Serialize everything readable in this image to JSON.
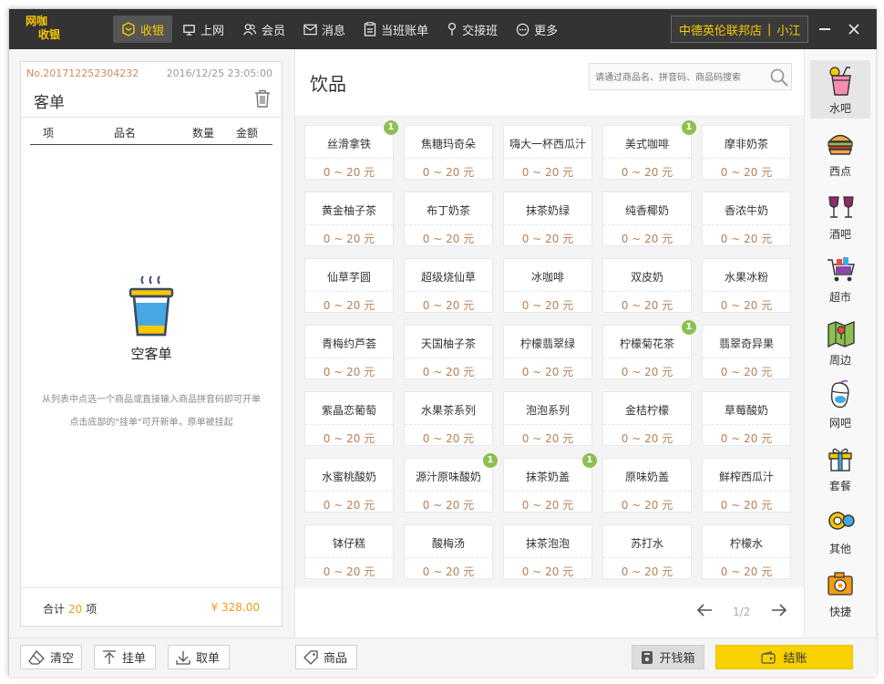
{
  "app": {
    "logo_line1": "网咖",
    "logo_line2": "收银"
  },
  "nav": [
    {
      "label": "收银",
      "icon": "cashier-icon",
      "active": true
    },
    {
      "label": "上网",
      "icon": "monitor-icon",
      "active": false
    },
    {
      "label": "会员",
      "icon": "members-icon",
      "active": false
    },
    {
      "label": "消息",
      "icon": "mail-icon",
      "active": false
    },
    {
      "label": "当班账单",
      "icon": "bill-icon",
      "active": false
    },
    {
      "label": "交接班",
      "icon": "pin-icon",
      "active": false
    },
    {
      "label": "更多",
      "icon": "more-icon",
      "active": false
    }
  ],
  "store": {
    "name": "中德英伦联邦店",
    "user": "小江"
  },
  "order": {
    "number": "No.201712252304232",
    "time": "2016/12/25 23:05:00",
    "title": "客单",
    "columns": [
      "项",
      "品名",
      "数量",
      "金额"
    ],
    "empty_title": "空客单",
    "hint1": "从列表中点选一个商品或直接输入商品拼音码即可开单",
    "hint2": "点击底部的\"挂单\"可开新单，原单被挂起",
    "sum_label": "合计",
    "sum_count": "20",
    "sum_unit": "项",
    "sum_amount": "¥ 328.00"
  },
  "category": {
    "title": "饮品",
    "search_placeholder": "请通过商品名、拼音码、商品码搜索"
  },
  "products": [
    {
      "name": "丝滑拿铁",
      "price": "0 ~ 20 元",
      "badge": "1"
    },
    {
      "name": "焦糖玛奇朵",
      "price": "0 ~ 20 元",
      "badge": ""
    },
    {
      "name": "嗨大一杯西瓜汁",
      "price": "0 ~ 20 元",
      "badge": ""
    },
    {
      "name": "美式咖啡",
      "price": "0 ~ 20 元",
      "badge": "1"
    },
    {
      "name": "摩非奶茶",
      "price": "0 ~ 20 元",
      "badge": ""
    },
    {
      "name": "黄金柚子茶",
      "price": "0 ~ 20 元",
      "badge": ""
    },
    {
      "name": "布丁奶茶",
      "price": "0 ~ 20 元",
      "badge": ""
    },
    {
      "name": "抹茶奶绿",
      "price": "0 ~ 20 元",
      "badge": ""
    },
    {
      "name": "纯香椰奶",
      "price": "0 ~ 20 元",
      "badge": ""
    },
    {
      "name": "香浓牛奶",
      "price": "0 ~ 20 元",
      "badge": ""
    },
    {
      "name": "仙草芋圆",
      "price": "0 ~ 20 元",
      "badge": ""
    },
    {
      "name": "超级烧仙草",
      "price": "0 ~ 20 元",
      "badge": ""
    },
    {
      "name": "冰咖啡",
      "price": "0 ~ 20 元",
      "badge": ""
    },
    {
      "name": "双皮奶",
      "price": "0 ~ 20 元",
      "badge": ""
    },
    {
      "name": "水果冰粉",
      "price": "0 ~ 20 元",
      "badge": ""
    },
    {
      "name": "青梅约芦荟",
      "price": "0 ~ 20 元",
      "badge": ""
    },
    {
      "name": "天国柚子茶",
      "price": "0 ~ 20 元",
      "badge": ""
    },
    {
      "name": "柠檬翡翠绿",
      "price": "0 ~ 20 元",
      "badge": ""
    },
    {
      "name": "柠檬菊花茶",
      "price": "0 ~ 20 元",
      "badge": "1"
    },
    {
      "name": "翡翠奇异果",
      "price": "0 ~ 20 元",
      "badge": ""
    },
    {
      "name": "紫晶恋葡萄",
      "price": "0 ~ 20 元",
      "badge": ""
    },
    {
      "name": "水果茶系列",
      "price": "0 ~ 20 元",
      "badge": ""
    },
    {
      "name": "泡泡系列",
      "price": "0 ~ 20 元",
      "badge": ""
    },
    {
      "name": "金桔柠檬",
      "price": "0 ~ 20 元",
      "badge": ""
    },
    {
      "name": "草莓酸奶",
      "price": "0 ~ 20 元",
      "badge": ""
    },
    {
      "name": "水蜜桃酸奶",
      "price": "0 ~ 20 元",
      "badge": ""
    },
    {
      "name": "源汁原味酸奶",
      "price": "0 ~ 20 元",
      "badge": "1"
    },
    {
      "name": "抹茶奶盖",
      "price": "0 ~ 20 元",
      "badge": "1"
    },
    {
      "name": "原味奶盖",
      "price": "0 ~ 20 元",
      "badge": ""
    },
    {
      "name": "鲜榨西瓜汁",
      "price": "0 ~ 20 元",
      "badge": ""
    },
    {
      "name": "钵仔糕",
      "price": "0 ~ 20 元",
      "badge": ""
    },
    {
      "name": "酸梅汤",
      "price": "0 ~ 20 元",
      "badge": ""
    },
    {
      "name": "抹茶泡泡",
      "price": "0 ~ 20 元",
      "badge": ""
    },
    {
      "name": "苏打水",
      "price": "0 ~ 20 元",
      "badge": ""
    },
    {
      "name": "柠檬水",
      "price": "0 ~ 20 元",
      "badge": ""
    }
  ],
  "pagination": {
    "label": "1/2"
  },
  "categories": [
    {
      "label": "水吧",
      "icon": "drink-icon",
      "active": true
    },
    {
      "label": "西点",
      "icon": "burger-icon",
      "active": false
    },
    {
      "label": "酒吧",
      "icon": "wine-icon",
      "active": false
    },
    {
      "label": "超市",
      "icon": "cart-icon",
      "active": false
    },
    {
      "label": "周边",
      "icon": "map-icon",
      "active": false
    },
    {
      "label": "网吧",
      "icon": "mouse-icon",
      "active": false
    },
    {
      "label": "套餐",
      "icon": "gift-icon",
      "active": false
    },
    {
      "label": "其他",
      "icon": "other-icon",
      "active": false
    },
    {
      "label": "快捷",
      "icon": "camera-icon",
      "active": false
    }
  ],
  "bottom": {
    "clear": "清空",
    "hold": "挂单",
    "fetch": "取单",
    "goods": "商品",
    "cashbox": "开钱箱",
    "pay": "结账"
  },
  "colors": {
    "accent": "#f7c800",
    "topbar": "#333333",
    "badge": "#8cc152",
    "price": "#b7815a",
    "sum": "#f39c12"
  }
}
